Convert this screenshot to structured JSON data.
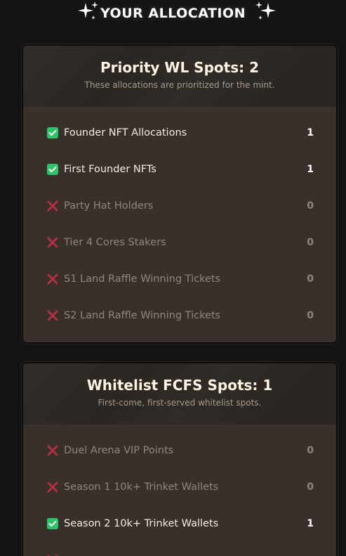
{
  "header": {
    "title": "YOUR ALLOCATION"
  },
  "priority": {
    "title": "Priority WL Spots: 2",
    "subtitle": "These allocations are prioritized for the mint.",
    "items": [
      {
        "label": "Founder NFT Allocations",
        "value": "1",
        "status": "check"
      },
      {
        "label": "First Founder NFTs",
        "value": "1",
        "status": "check"
      },
      {
        "label": "Party Hat Holders",
        "value": "0",
        "status": "cross"
      },
      {
        "label": "Tier 4 Cores Stakers",
        "value": "0",
        "status": "cross"
      },
      {
        "label": "S1 Land Raffle Winning Tickets",
        "value": "0",
        "status": "cross"
      },
      {
        "label": "S2 Land Raffle Winning Tickets",
        "value": "0",
        "status": "cross"
      }
    ]
  },
  "whitelist": {
    "title": "Whitelist FCFS Spots: 1",
    "subtitle": "First-come, first-served whitelist spots.",
    "items": [
      {
        "label": "Duel Arena VIP Points",
        "value": "0",
        "status": "cross"
      },
      {
        "label": "Season 1 10k+ Trinket Wallets",
        "value": "0",
        "status": "cross"
      },
      {
        "label": "Season 2 10k+ Trinket Wallets",
        "value": "1",
        "status": "check"
      }
    ]
  },
  "colors": {
    "background": "#141414",
    "card": "#3a302b",
    "card_header": "#2b2622",
    "check": "#2ec46a",
    "cross": "#b0313f"
  },
  "icons": {
    "check": "check-icon",
    "cross": "cross-icon",
    "sparkle": "sparkle-icon"
  }
}
